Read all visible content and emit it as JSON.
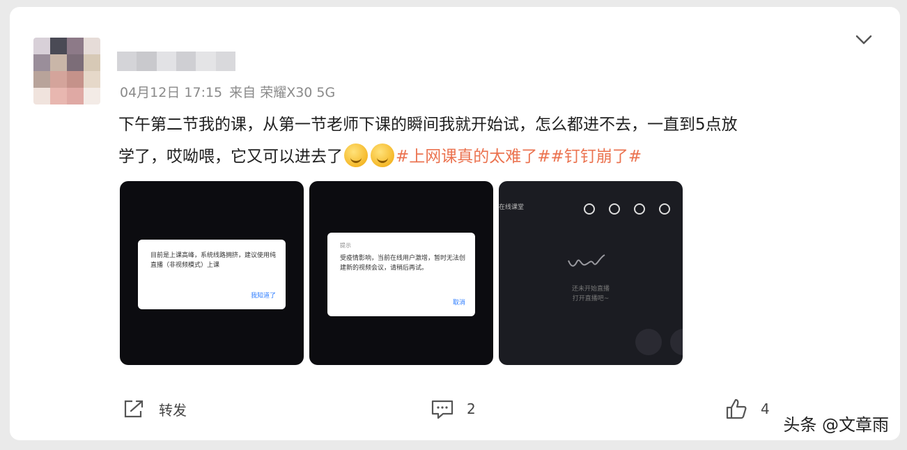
{
  "post": {
    "time": "04月12日 17:15",
    "source": "来自 荣耀X30 5G",
    "text_line1": "下午第二节我的课，从第一节老师下课的瞬间我就开始试，怎么都进不去，一直到5点放",
    "text_line2": "学了，哎呦喂，它又可以进去了",
    "hashtags": "#上网课真的太难了##钉钉崩了#",
    "emoji_names": [
      "grin-emoji",
      "grin-emoji"
    ]
  },
  "images": [
    {
      "dialog_text": "目前是上课高峰，系统线路拥挤，建议使用纯直播（非视频模式）上课",
      "dialog_button": "我知道了"
    },
    {
      "dialog_title": "提示",
      "dialog_text": "受疫情影响，当前在线用户激增，暂时无法创建新的视频会议，请稍后再试。",
      "dialog_button": "取消"
    },
    {
      "top_label": "在线课堂",
      "center_text_1": "还未开始直播",
      "center_text_2": "打开直播吧~"
    }
  ],
  "actions": {
    "forward_label": "转发",
    "comment_count": "2",
    "like_count": "4"
  },
  "watermark": "头条 @文章雨",
  "colors": {
    "hashtag": "#eb7350",
    "meta": "#8a8a8a"
  }
}
